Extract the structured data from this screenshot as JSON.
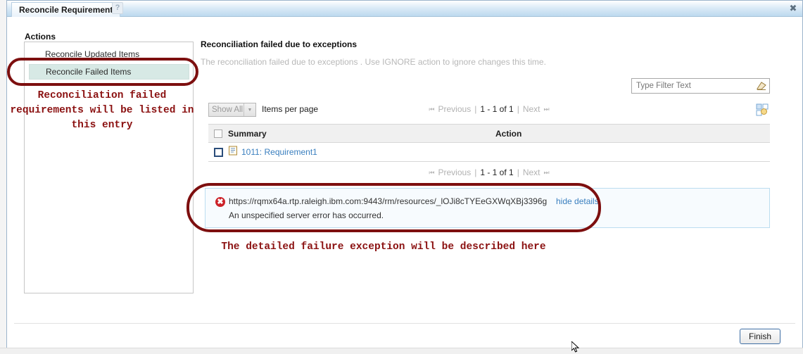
{
  "window": {
    "title": "Reconcile Requirement",
    "help_icon": "question-mark-icon",
    "close_icon": "close-icon"
  },
  "sidebar": {
    "label": "Actions",
    "items": [
      {
        "label": "Reconcile Updated Items",
        "selected": false
      },
      {
        "label": "Reconcile Failed Items",
        "selected": true
      }
    ]
  },
  "main": {
    "title": "Reconciliation failed due to exceptions",
    "subtitle": "The reconciliation failed due to exceptions . Use IGNORE action to ignore changes this time.",
    "filter": {
      "placeholder": "Type Filter Text",
      "value": "",
      "clear_icon": "eraser-icon"
    },
    "toolbar": {
      "page_size_value": "Show All",
      "page_size_caret": "▼",
      "items_per_page_label": "Items per page",
      "columns_icon": "configure-columns-icon"
    },
    "pagination": {
      "first_icon": "⏮",
      "previous_label": "Previous",
      "separator": "|",
      "range_label": "1 - 1 of 1",
      "next_label": "Next",
      "last_icon": "⏭"
    },
    "table": {
      "columns": [
        "Summary",
        "Action"
      ],
      "rows": [
        {
          "summary": "1011: Requirement1",
          "action": "",
          "icon": "document-icon",
          "checked": false
        }
      ]
    },
    "error": {
      "icon": "error-icon",
      "url": "https://rqmx64a.rtp.raleigh.ibm.com:9443/rm/resources/_lOJi8cTYEeGXWqXBj3396g",
      "toggle_label": "hide details",
      "message": "An unspecified server error has occurred."
    }
  },
  "annotations": [
    {
      "text": "Reconciliation failed\nrequirements will be listed in\nthis entry"
    },
    {
      "text": "The detailed failure exception will be described here"
    }
  ],
  "footer": {
    "finish_label": "Finish"
  },
  "colors": {
    "annotation": "#8b1111",
    "selection": "#d7e9e5",
    "link": "#3a7fbf",
    "error": "#cc2229"
  }
}
